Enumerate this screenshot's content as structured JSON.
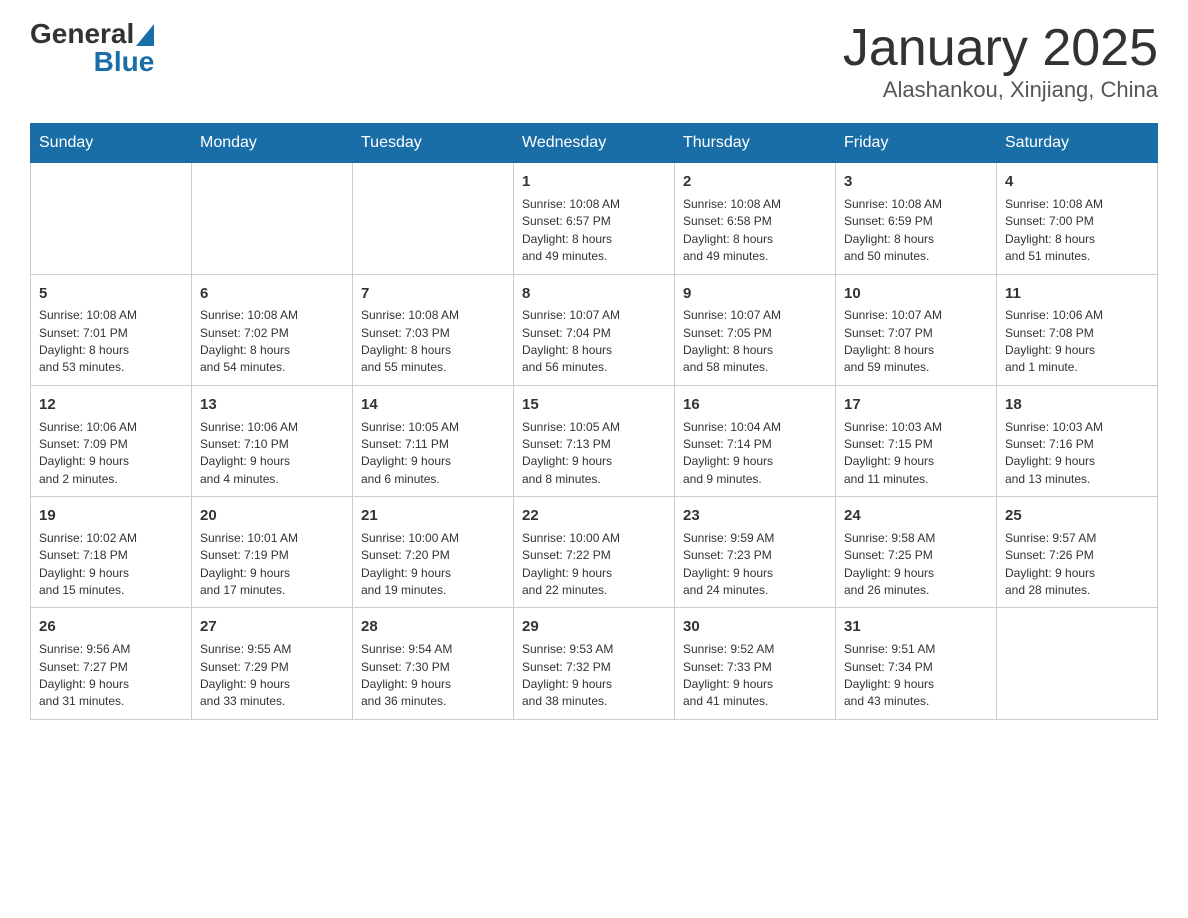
{
  "header": {
    "logo_general": "General",
    "logo_blue": "Blue",
    "title": "January 2025",
    "subtitle": "Alashankou, Xinjiang, China"
  },
  "days_of_week": [
    "Sunday",
    "Monday",
    "Tuesday",
    "Wednesday",
    "Thursday",
    "Friday",
    "Saturday"
  ],
  "weeks": [
    [
      {
        "day": "",
        "info": ""
      },
      {
        "day": "",
        "info": ""
      },
      {
        "day": "",
        "info": ""
      },
      {
        "day": "1",
        "info": "Sunrise: 10:08 AM\nSunset: 6:57 PM\nDaylight: 8 hours\nand 49 minutes."
      },
      {
        "day": "2",
        "info": "Sunrise: 10:08 AM\nSunset: 6:58 PM\nDaylight: 8 hours\nand 49 minutes."
      },
      {
        "day": "3",
        "info": "Sunrise: 10:08 AM\nSunset: 6:59 PM\nDaylight: 8 hours\nand 50 minutes."
      },
      {
        "day": "4",
        "info": "Sunrise: 10:08 AM\nSunset: 7:00 PM\nDaylight: 8 hours\nand 51 minutes."
      }
    ],
    [
      {
        "day": "5",
        "info": "Sunrise: 10:08 AM\nSunset: 7:01 PM\nDaylight: 8 hours\nand 53 minutes."
      },
      {
        "day": "6",
        "info": "Sunrise: 10:08 AM\nSunset: 7:02 PM\nDaylight: 8 hours\nand 54 minutes."
      },
      {
        "day": "7",
        "info": "Sunrise: 10:08 AM\nSunset: 7:03 PM\nDaylight: 8 hours\nand 55 minutes."
      },
      {
        "day": "8",
        "info": "Sunrise: 10:07 AM\nSunset: 7:04 PM\nDaylight: 8 hours\nand 56 minutes."
      },
      {
        "day": "9",
        "info": "Sunrise: 10:07 AM\nSunset: 7:05 PM\nDaylight: 8 hours\nand 58 minutes."
      },
      {
        "day": "10",
        "info": "Sunrise: 10:07 AM\nSunset: 7:07 PM\nDaylight: 8 hours\nand 59 minutes."
      },
      {
        "day": "11",
        "info": "Sunrise: 10:06 AM\nSunset: 7:08 PM\nDaylight: 9 hours\nand 1 minute."
      }
    ],
    [
      {
        "day": "12",
        "info": "Sunrise: 10:06 AM\nSunset: 7:09 PM\nDaylight: 9 hours\nand 2 minutes."
      },
      {
        "day": "13",
        "info": "Sunrise: 10:06 AM\nSunset: 7:10 PM\nDaylight: 9 hours\nand 4 minutes."
      },
      {
        "day": "14",
        "info": "Sunrise: 10:05 AM\nSunset: 7:11 PM\nDaylight: 9 hours\nand 6 minutes."
      },
      {
        "day": "15",
        "info": "Sunrise: 10:05 AM\nSunset: 7:13 PM\nDaylight: 9 hours\nand 8 minutes."
      },
      {
        "day": "16",
        "info": "Sunrise: 10:04 AM\nSunset: 7:14 PM\nDaylight: 9 hours\nand 9 minutes."
      },
      {
        "day": "17",
        "info": "Sunrise: 10:03 AM\nSunset: 7:15 PM\nDaylight: 9 hours\nand 11 minutes."
      },
      {
        "day": "18",
        "info": "Sunrise: 10:03 AM\nSunset: 7:16 PM\nDaylight: 9 hours\nand 13 minutes."
      }
    ],
    [
      {
        "day": "19",
        "info": "Sunrise: 10:02 AM\nSunset: 7:18 PM\nDaylight: 9 hours\nand 15 minutes."
      },
      {
        "day": "20",
        "info": "Sunrise: 10:01 AM\nSunset: 7:19 PM\nDaylight: 9 hours\nand 17 minutes."
      },
      {
        "day": "21",
        "info": "Sunrise: 10:00 AM\nSunset: 7:20 PM\nDaylight: 9 hours\nand 19 minutes."
      },
      {
        "day": "22",
        "info": "Sunrise: 10:00 AM\nSunset: 7:22 PM\nDaylight: 9 hours\nand 22 minutes."
      },
      {
        "day": "23",
        "info": "Sunrise: 9:59 AM\nSunset: 7:23 PM\nDaylight: 9 hours\nand 24 minutes."
      },
      {
        "day": "24",
        "info": "Sunrise: 9:58 AM\nSunset: 7:25 PM\nDaylight: 9 hours\nand 26 minutes."
      },
      {
        "day": "25",
        "info": "Sunrise: 9:57 AM\nSunset: 7:26 PM\nDaylight: 9 hours\nand 28 minutes."
      }
    ],
    [
      {
        "day": "26",
        "info": "Sunrise: 9:56 AM\nSunset: 7:27 PM\nDaylight: 9 hours\nand 31 minutes."
      },
      {
        "day": "27",
        "info": "Sunrise: 9:55 AM\nSunset: 7:29 PM\nDaylight: 9 hours\nand 33 minutes."
      },
      {
        "day": "28",
        "info": "Sunrise: 9:54 AM\nSunset: 7:30 PM\nDaylight: 9 hours\nand 36 minutes."
      },
      {
        "day": "29",
        "info": "Sunrise: 9:53 AM\nSunset: 7:32 PM\nDaylight: 9 hours\nand 38 minutes."
      },
      {
        "day": "30",
        "info": "Sunrise: 9:52 AM\nSunset: 7:33 PM\nDaylight: 9 hours\nand 41 minutes."
      },
      {
        "day": "31",
        "info": "Sunrise: 9:51 AM\nSunset: 7:34 PM\nDaylight: 9 hours\nand 43 minutes."
      },
      {
        "day": "",
        "info": ""
      }
    ]
  ]
}
